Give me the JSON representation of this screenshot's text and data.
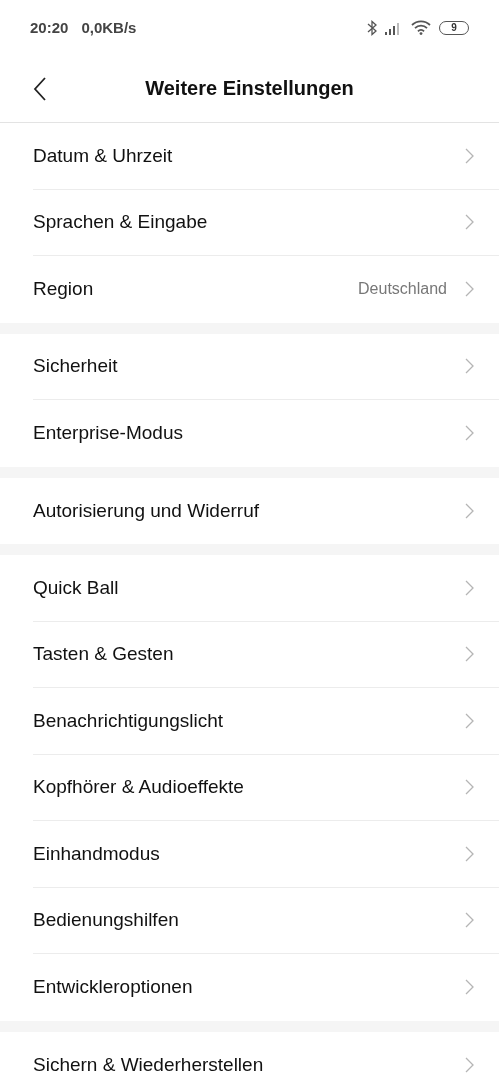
{
  "status_bar": {
    "time": "20:20",
    "speed": "0,0KB/s",
    "battery": "9"
  },
  "header": {
    "title": "Weitere Einstellungen"
  },
  "sections": [
    {
      "items": [
        {
          "label": "Datum & Uhrzeit"
        },
        {
          "label": "Sprachen & Eingabe"
        },
        {
          "label": "Region",
          "value": "Deutschland"
        }
      ]
    },
    {
      "items": [
        {
          "label": "Sicherheit"
        },
        {
          "label": "Enterprise-Modus"
        }
      ]
    },
    {
      "items": [
        {
          "label": "Autorisierung und Widerruf"
        }
      ]
    },
    {
      "items": [
        {
          "label": "Quick Ball"
        },
        {
          "label": "Tasten & Gesten"
        },
        {
          "label": "Benachrichtigungslicht"
        },
        {
          "label": "Kopfhörer & Audioeffekte"
        },
        {
          "label": "Einhandmodus"
        },
        {
          "label": "Bedienungshilfen"
        },
        {
          "label": "Entwickleroptionen"
        }
      ]
    },
    {
      "items": [
        {
          "label": "Sichern & Wiederherstellen"
        }
      ]
    }
  ]
}
